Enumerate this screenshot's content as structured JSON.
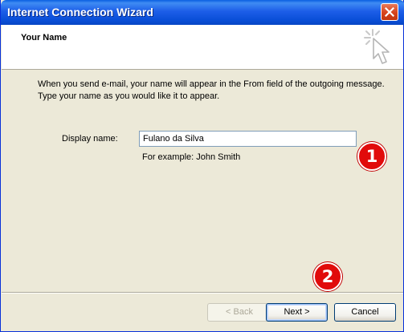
{
  "window": {
    "title": "Internet Connection Wizard"
  },
  "titlebar": {
    "close_icon": "close-x-icon"
  },
  "header": {
    "title": "Your Name",
    "icon": "wizard-wand-cursor-icon"
  },
  "description": {
    "line1": "When you send e-mail, your name will appear in the From field of the outgoing message.",
    "line2": "Type your name as you would like it to appear."
  },
  "form": {
    "display_name_label": "Display name:",
    "display_name_value": "Fulano da Silva",
    "example_text": "For example: John Smith"
  },
  "markers": [
    {
      "label": "1",
      "color": "#e10b0b"
    },
    {
      "label": "2",
      "color": "#e10b0b"
    }
  ],
  "buttons": {
    "back": "< Back",
    "next": "Next >",
    "cancel": "Cancel"
  },
  "colors": {
    "titlebar": "#0a4fd8",
    "window_bg": "#ece9d8",
    "close_button": "#d7431b"
  }
}
